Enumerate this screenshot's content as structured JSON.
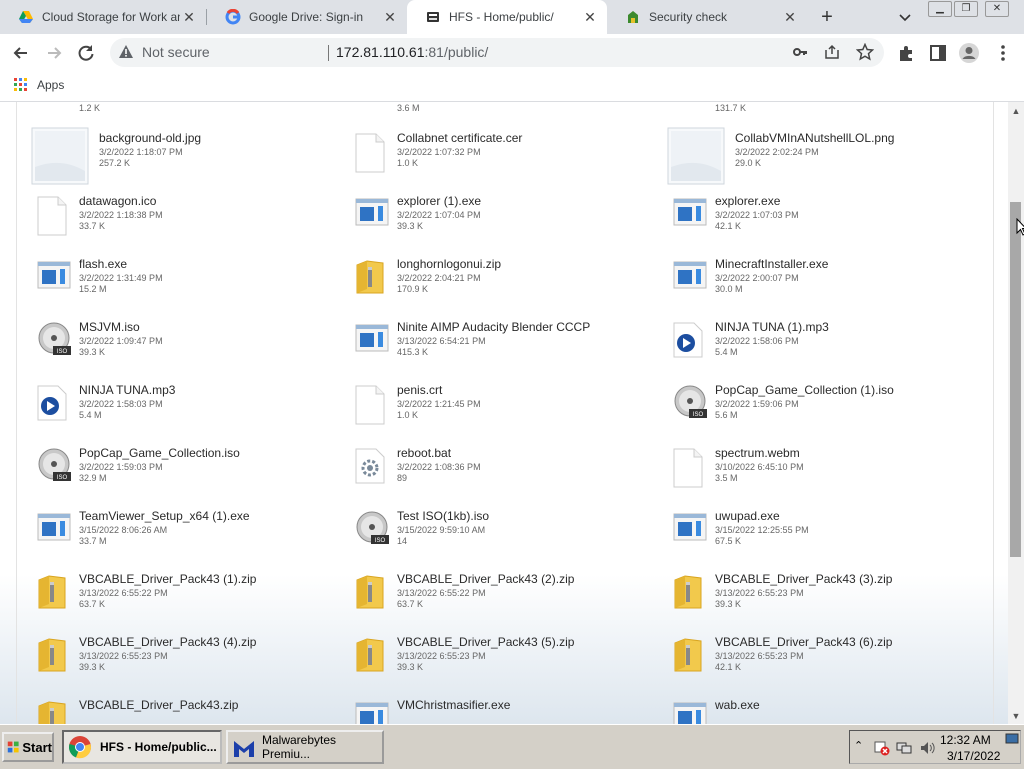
{
  "tabs": [
    {
      "title": "Cloud Storage for Work and",
      "icon": "google-drive-icon",
      "active": false
    },
    {
      "title": "Google Drive: Sign-in",
      "icon": "google-icon",
      "active": false
    },
    {
      "title": "HFS - Home/public/",
      "icon": "hfs-icon",
      "active": true
    },
    {
      "title": "Security check",
      "icon": "security-icon",
      "active": false
    }
  ],
  "toolbar": {
    "security_label": "Not secure",
    "url_host": "172.81.110.61",
    "url_rest": ":81/public/"
  },
  "bookmarks": {
    "apps_label": "Apps"
  },
  "top_partial": [
    {
      "size": "1.2 K"
    },
    {
      "size": "3.6 M"
    },
    {
      "size": "131.7 K"
    }
  ],
  "files": [
    {
      "name": "background-old.jpg",
      "date": "3/2/2022 1:18:07 PM",
      "size": "257.2 K",
      "icon": "image-thumbnail-icon"
    },
    {
      "name": "Collabnet certificate.cer",
      "date": "3/2/2022 1:07:32 PM",
      "size": "1.0 K",
      "icon": "file-icon"
    },
    {
      "name": "CollabVMInANutshellLOL.png",
      "date": "3/2/2022 2:02:24 PM",
      "size": "29.0 K",
      "icon": "image-thumbnail-icon"
    },
    {
      "name": "datawagon.ico",
      "date": "3/2/2022 1:18:38 PM",
      "size": "33.7 K",
      "icon": "file-icon"
    },
    {
      "name": "explorer (1).exe",
      "date": "3/2/2022 1:07:04 PM",
      "size": "39.3 K",
      "icon": "exe-icon"
    },
    {
      "name": "explorer.exe",
      "date": "3/2/2022 1:07:03 PM",
      "size": "42.1 K",
      "icon": "exe-icon"
    },
    {
      "name": "flash.exe",
      "date": "3/2/2022 1:31:49 PM",
      "size": "15.2 M",
      "icon": "exe-icon"
    },
    {
      "name": "longhornlogonui.zip",
      "date": "3/2/2022 2:04:21 PM",
      "size": "170.9 K",
      "icon": "zip-icon"
    },
    {
      "name": "MinecraftInstaller.exe",
      "date": "3/2/2022 2:00:07 PM",
      "size": "30.0 M",
      "icon": "exe-icon"
    },
    {
      "name": "MSJVM.iso",
      "date": "3/2/2022 1:09:47 PM",
      "size": "39.3 K",
      "icon": "iso-icon"
    },
    {
      "name": "Ninite AIMP Audacity Blender CCCP",
      "date": "3/13/2022 6:54:21 PM",
      "size": "415.3 K",
      "icon": "exe-icon"
    },
    {
      "name": "NINJA TUNA (1).mp3",
      "date": "3/2/2022 1:58:06 PM",
      "size": "5.4 M",
      "icon": "media-icon"
    },
    {
      "name": "NINJA TUNA.mp3",
      "date": "3/2/2022 1:58:03 PM",
      "size": "5.4 M",
      "icon": "media-icon"
    },
    {
      "name": "penis.crt",
      "date": "3/2/2022 1:21:45 PM",
      "size": "1.0 K",
      "icon": "file-icon"
    },
    {
      "name": "PopCap_Game_Collection (1).iso",
      "date": "3/2/2022 1:59:06 PM",
      "size": "5.6 M",
      "icon": "iso-icon"
    },
    {
      "name": "PopCap_Game_Collection.iso",
      "date": "3/2/2022 1:59:03 PM",
      "size": "32.9 M",
      "icon": "iso-icon"
    },
    {
      "name": "reboot.bat",
      "date": "3/2/2022 1:08:36 PM",
      "size": "89",
      "icon": "batch-icon"
    },
    {
      "name": "spectrum.webm",
      "date": "3/10/2022 6:45:10 PM",
      "size": "3.5 M",
      "icon": "file-icon"
    },
    {
      "name": "TeamViewer_Setup_x64 (1).exe",
      "date": "3/15/2022 8:06:26 AM",
      "size": "33.7 M",
      "icon": "exe-icon"
    },
    {
      "name": "Test ISO(1kb).iso",
      "date": "3/15/2022 9:59:10 AM",
      "size": "14",
      "icon": "iso-icon"
    },
    {
      "name": "uwupad.exe",
      "date": "3/15/2022 12:25:55 PM",
      "size": "67.5 K",
      "icon": "exe-icon"
    },
    {
      "name": "VBCABLE_Driver_Pack43 (1).zip",
      "date": "3/13/2022 6:55:22 PM",
      "size": "63.7 K",
      "icon": "zip-icon"
    },
    {
      "name": "VBCABLE_Driver_Pack43 (2).zip",
      "date": "3/13/2022 6:55:22 PM",
      "size": "63.7 K",
      "icon": "zip-icon"
    },
    {
      "name": "VBCABLE_Driver_Pack43 (3).zip",
      "date": "3/13/2022 6:55:23 PM",
      "size": "39.3 K",
      "icon": "zip-icon"
    },
    {
      "name": "VBCABLE_Driver_Pack43 (4).zip",
      "date": "3/13/2022 6:55:23 PM",
      "size": "39.3 K",
      "icon": "zip-icon"
    },
    {
      "name": "VBCABLE_Driver_Pack43 (5).zip",
      "date": "3/13/2022 6:55:23 PM",
      "size": "39.3 K",
      "icon": "zip-icon"
    },
    {
      "name": "VBCABLE_Driver_Pack43 (6).zip",
      "date": "3/13/2022 6:55:23 PM",
      "size": "42.1 K",
      "icon": "zip-icon"
    },
    {
      "name": "VBCABLE_Driver_Pack43.zip",
      "date": "",
      "size": "",
      "icon": "zip-icon"
    },
    {
      "name": "VMChristmasifier.exe",
      "date": "",
      "size": "",
      "icon": "exe-icon"
    },
    {
      "name": "wab.exe",
      "date": "",
      "size": "",
      "icon": "exe-icon"
    }
  ],
  "taskbar": {
    "start_label": "Start",
    "items": [
      {
        "label": "HFS - Home/public...",
        "icon": "chrome-icon",
        "active": true
      },
      {
        "label": "Malwarebytes Premiu...",
        "icon": "malwarebytes-icon",
        "active": false
      }
    ],
    "time": "12:32 AM",
    "date": "3/17/2022"
  }
}
